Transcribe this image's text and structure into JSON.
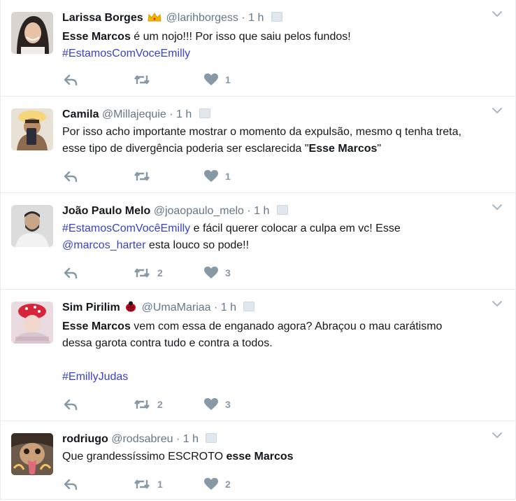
{
  "tweets": [
    {
      "name": "Larissa Borges",
      "handle": "@larihborgess",
      "time": "1 h",
      "has_crown": true,
      "text_lines": [
        [
          {
            "t": "Esse Marcos",
            "s": "bold"
          },
          {
            "t": " é um nojo!!! Por isso que saiu pelos fundos!",
            "s": "plain"
          }
        ],
        [
          {
            "t": "#EstamosComVoceEmilly",
            "s": "link"
          }
        ]
      ],
      "retweets": "",
      "likes": "1"
    },
    {
      "name": "Camila",
      "handle": "@Millajequie",
      "time": "1 h",
      "text_lines": [
        [
          {
            "t": "Por isso acho importante mostrar o momento da expulsão, mesmo q tenha treta,",
            "s": "plain"
          }
        ],
        [
          {
            "t": "esse tipo de divergência poderia ser esclarecida \"",
            "s": "plain"
          },
          {
            "t": "Esse Marcos",
            "s": "bold"
          },
          {
            "t": "\"",
            "s": "plain"
          }
        ]
      ],
      "retweets": "",
      "likes": "1"
    },
    {
      "name": "João Paulo Melo",
      "handle": "@joaopaulo_melo",
      "time": "1 h",
      "text_lines": [
        [
          {
            "t": "#EstamosComVocêEmilly",
            "s": "link"
          },
          {
            "t": " e fácil querer colocar a culpa em vc! Esse",
            "s": "plain"
          }
        ],
        [
          {
            "t": "@marcos_harter",
            "s": "link"
          },
          {
            "t": " esta louco so pode!!",
            "s": "plain"
          }
        ]
      ],
      "retweets": "2",
      "likes": "3"
    },
    {
      "name": "Sim Pirilim",
      "handle": "@UmaMariaa",
      "time": "1 h",
      "has_ladybug": true,
      "text_lines": [
        [
          {
            "t": "Esse Marcos",
            "s": "bold"
          },
          {
            "t": " vem com essa de enganado agora? Abraçou o mau carátismo",
            "s": "plain"
          }
        ],
        [
          {
            "t": "dessa garota contra tudo e contra a todos.",
            "s": "plain"
          }
        ],
        [],
        [
          {
            "t": "#EmillyJudas",
            "s": "link"
          }
        ]
      ],
      "retweets": "2",
      "likes": "3"
    },
    {
      "name": "rodriugo",
      "handle": "@rodsabreu",
      "time": "1 h",
      "text_lines": [
        [
          {
            "t": "Que grandessíssimo ESCROTO ",
            "s": "plain"
          },
          {
            "t": "esse Marcos",
            "s": "bold"
          }
        ]
      ],
      "retweets": "1",
      "likes": "2"
    }
  ],
  "colors": {
    "link": "#3b41c8",
    "icon": "#8899a6",
    "border": "#e6ecf0",
    "secondary_text": "#657786"
  },
  "icons": {
    "reply": "reply-icon",
    "retweet": "retweet-icon",
    "like": "heart-icon",
    "more": "chevron-down-icon"
  }
}
